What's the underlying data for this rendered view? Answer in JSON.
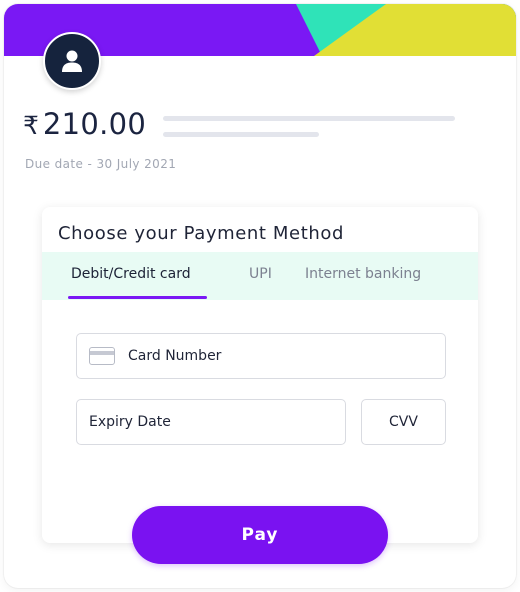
{
  "colors": {
    "banner_purple": "#7a18f4",
    "banner_teal": "#2fe3b8",
    "banner_yellow": "#e1df35",
    "accent": "#7a12f1",
    "tabs_background": "#e8fbf4",
    "text_dark": "#1b2440",
    "text_muted": "#a2a7b3"
  },
  "avatar": {
    "icon": "user-icon"
  },
  "summary": {
    "currency_symbol": "₹",
    "amount": "210.00",
    "due_date": "Due date - 30 July 2021"
  },
  "payment_method": {
    "title": "Choose your Payment Method",
    "tabs": [
      {
        "label": "Debit/Credit card",
        "active": true
      },
      {
        "label": "UPI",
        "active": false
      },
      {
        "label": "Internet banking",
        "active": false
      }
    ],
    "fields": {
      "card_number": {
        "placeholder": "Card Number",
        "icon": "credit-card-icon"
      },
      "expiry_date": {
        "placeholder": "Expiry Date"
      },
      "cvv": {
        "placeholder": "CVV"
      }
    }
  },
  "pay_button": {
    "label": "Pay"
  }
}
